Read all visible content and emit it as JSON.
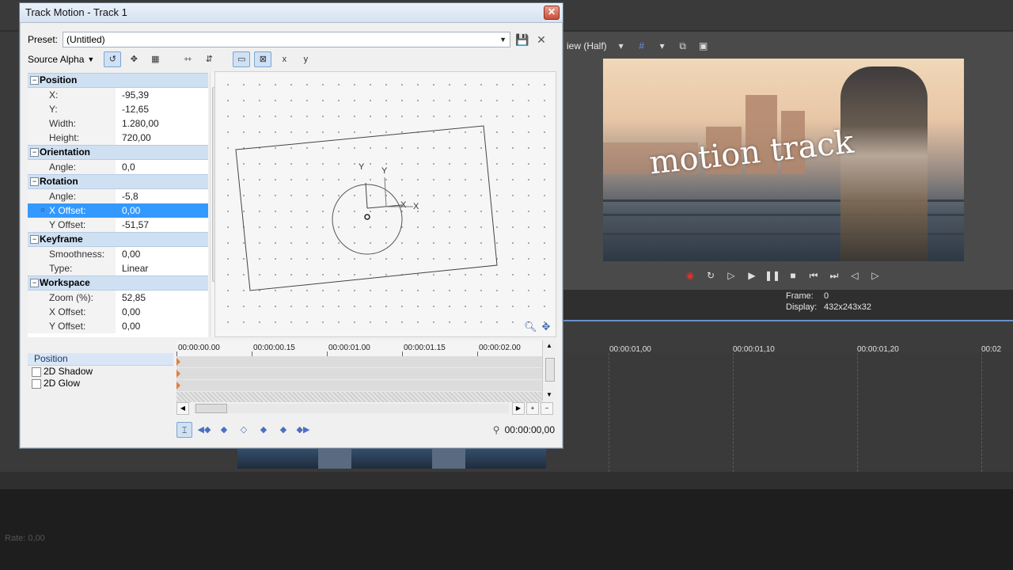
{
  "dialog": {
    "title": "Track Motion - Track 1",
    "preset_label": "Preset:",
    "preset_value": "(Untitled)",
    "source_alpha_label": "Source Alpha"
  },
  "properties": [
    {
      "section": "Position",
      "rows": [
        {
          "name": "X:",
          "value": "-95,39"
        },
        {
          "name": "Y:",
          "value": "-12,65"
        },
        {
          "name": "Width:",
          "value": "1.280,00"
        },
        {
          "name": "Height:",
          "value": "720,00"
        }
      ]
    },
    {
      "section": "Orientation",
      "rows": [
        {
          "name": "Angle:",
          "value": "0,0"
        }
      ]
    },
    {
      "section": "Rotation",
      "rows": [
        {
          "name": "Angle:",
          "value": "-5,8"
        },
        {
          "name": "X Offset:",
          "value": "0,00",
          "selected": true
        },
        {
          "name": "Y Offset:",
          "value": "-51,57"
        }
      ]
    },
    {
      "section": "Keyframe",
      "rows": [
        {
          "name": "Smoothness:",
          "value": "0,00"
        },
        {
          "name": "Type:",
          "value": "Linear"
        }
      ]
    },
    {
      "section": "Workspace",
      "rows": [
        {
          "name": "Zoom (%):",
          "value": "52,85"
        },
        {
          "name": "X Offset:",
          "value": "0,00"
        },
        {
          "name": "Y Offset:",
          "value": "0,00"
        }
      ]
    }
  ],
  "workspace": {
    "axis_y": "Y",
    "axis_y2": "Y",
    "axis_x": "X",
    "axis_x2": "X"
  },
  "keyframe_tracks": {
    "header": "Position",
    "items": [
      "2D Shadow",
      "2D Glow"
    ]
  },
  "keyframe_ruler": [
    "00:00:00.00",
    "00:00:00.15",
    "00:00:01.00",
    "00:00:01.15",
    "00:00:02.00"
  ],
  "keyframe_time": "00:00:00,00",
  "preview": {
    "toolbar_label": "iew (Half)",
    "overlay_text": "motion track",
    "frame_label": "Frame:",
    "frame_value": "0",
    "display_label": "Display:",
    "display_value": "432x243x32"
  },
  "timeline_ruler": [
    "00:00:01,00",
    "00:00:01,10",
    "00:00:01,20",
    "00:02"
  ],
  "bottom": {
    "rate": "Rate: 0,00"
  },
  "colors": {
    "accent": "#3399ff",
    "section": "#cfe0f3",
    "record": "#e03030"
  }
}
